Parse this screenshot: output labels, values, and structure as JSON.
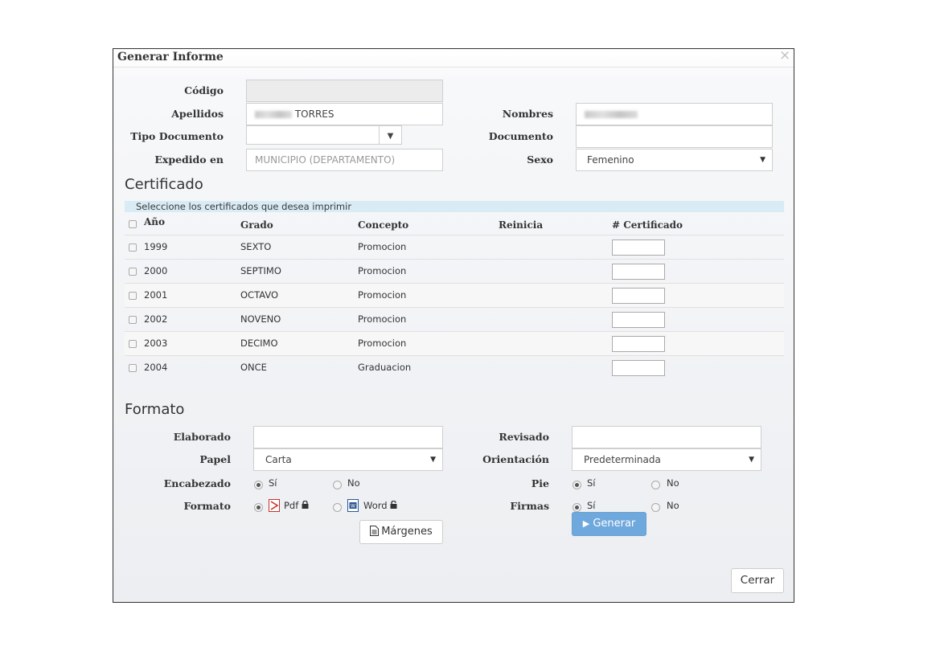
{
  "dialog": {
    "title": "Generar Informe",
    "close_symbol": "×"
  },
  "student": {
    "codigo_label": "Código",
    "codigo_value": "",
    "apellidos_label": "Apellidos",
    "apellidos_value": "TORRES",
    "nombres_label": "Nombres",
    "nombres_value": "",
    "tipo_doc_label": "Tipo Documento",
    "tipo_doc_value": "",
    "documento_label": "Documento",
    "documento_value": "",
    "expedido_label": "Expedido en",
    "expedido_placeholder": "MUNICIPIO (DEPARTAMENTO)",
    "sexo_label": "Sexo",
    "sexo_value": "Femenino"
  },
  "certificado": {
    "heading": "Certificado",
    "info": "Seleccione los certificados que desea imprimir",
    "columns": [
      "Año",
      "Grado",
      "Concepto",
      "Reinicia",
      "# Certificado"
    ],
    "rows": [
      {
        "year": "1999",
        "grado": "SEXTO",
        "concepto": "Promocion"
      },
      {
        "year": "2000",
        "grado": "SEPTIMO",
        "concepto": "Promocion"
      },
      {
        "year": "2001",
        "grado": "OCTAVO",
        "concepto": "Promocion"
      },
      {
        "year": "2002",
        "grado": "NOVENO",
        "concepto": "Promocion"
      },
      {
        "year": "2003",
        "grado": "DECIMO",
        "concepto": "Promocion"
      },
      {
        "year": "2004",
        "grado": "ONCE",
        "concepto": "Graduacion"
      }
    ]
  },
  "formato": {
    "heading": "Formato",
    "elaborado_label": "Elaborado",
    "revisado_label": "Revisado",
    "papel_label": "Papel",
    "papel_value": "Carta",
    "orientacion_label": "Orientación",
    "orientacion_value": "Predeterminada",
    "encabezado_label": "Encabezado",
    "pie_label": "Pie",
    "formato_label": "Formato",
    "firmas_label": "Firmas",
    "si": "Sí",
    "no": "No",
    "pdf": "Pdf",
    "word": "Word",
    "margenes_button": "Márgenes",
    "generar_button": "Generar",
    "generar_icon": "play-icon"
  },
  "footer": {
    "cerrar_button": "Cerrar"
  }
}
